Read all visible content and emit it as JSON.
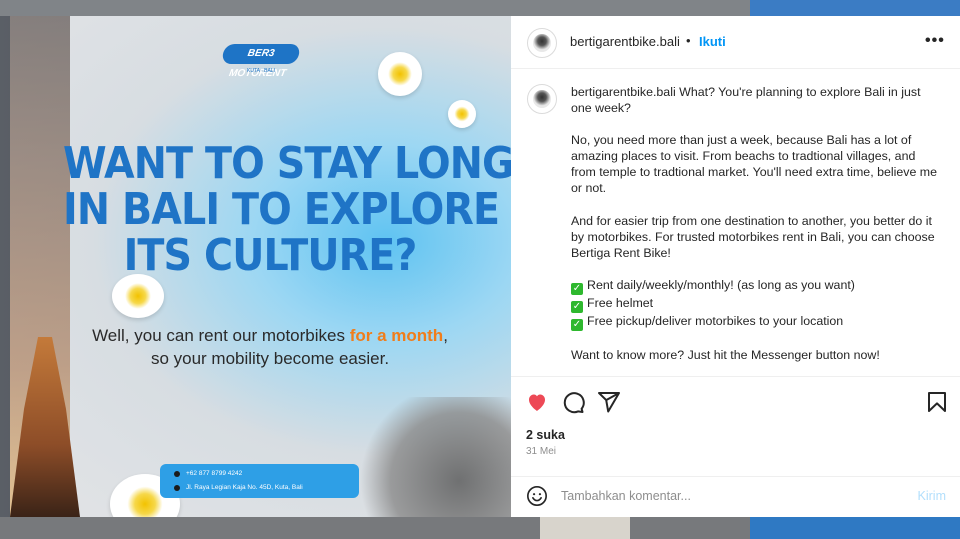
{
  "post_image": {
    "logo_text": "BER3 MOTORENT",
    "logo_sub": "KUTA · BALI",
    "headline_lines": [
      "WANT TO STAY LONGER",
      "IN BALI TO EXPLORE",
      "ITS CULTURE?"
    ],
    "subline_pre": "Well, you can rent our motorbikes ",
    "subline_highlight": "for a month",
    "subline_post": ",",
    "subline_line2": "so your mobility become easier.",
    "phone": "+62 877 8799 4242",
    "address": "Jl. Raya Legian Kaja No. 45D, Kuta, Bali"
  },
  "header": {
    "username": "bertigarentbike.bali",
    "dot": "•",
    "follow_label": "Ikuti",
    "more_label": "•••"
  },
  "caption": {
    "username": "bertigarentbike.bali",
    "p1": "What? You're planning to explore Bali in just one week?",
    "p2": "No, you need more than just a week, because Bali has a lot of amazing places to visit. From beachs to tradtional villages, and from temple to tradtional market. You'll need extra time, believe me or not.",
    "p3": "And for easier trip from one destination to another, you better do it by motorbikes. For trusted motorbikes rent in Bali, you can choose Bertiga Rent Bike!",
    "checks": [
      "Rent daily/weekly/monthly! (as long as you want)",
      "Free helmet",
      "Free pickup/deliver motorbikes to your location"
    ],
    "p4": "Want to know more? Just hit the Messenger button now!"
  },
  "engagement": {
    "likes": "2 suka",
    "date": "31 Mei"
  },
  "comment": {
    "placeholder": "Tambahkan komentar...",
    "send_label": "Kirim"
  },
  "colors": {
    "accent": "#0095f6",
    "like": "#ed4956",
    "headline": "#1f74c6",
    "highlight": "#f07d1a"
  },
  "icons": {
    "like": "heart-icon",
    "comment": "comment-icon",
    "share": "share-icon",
    "save": "bookmark-icon",
    "emoji": "emoji-icon",
    "more": "more-icon"
  }
}
